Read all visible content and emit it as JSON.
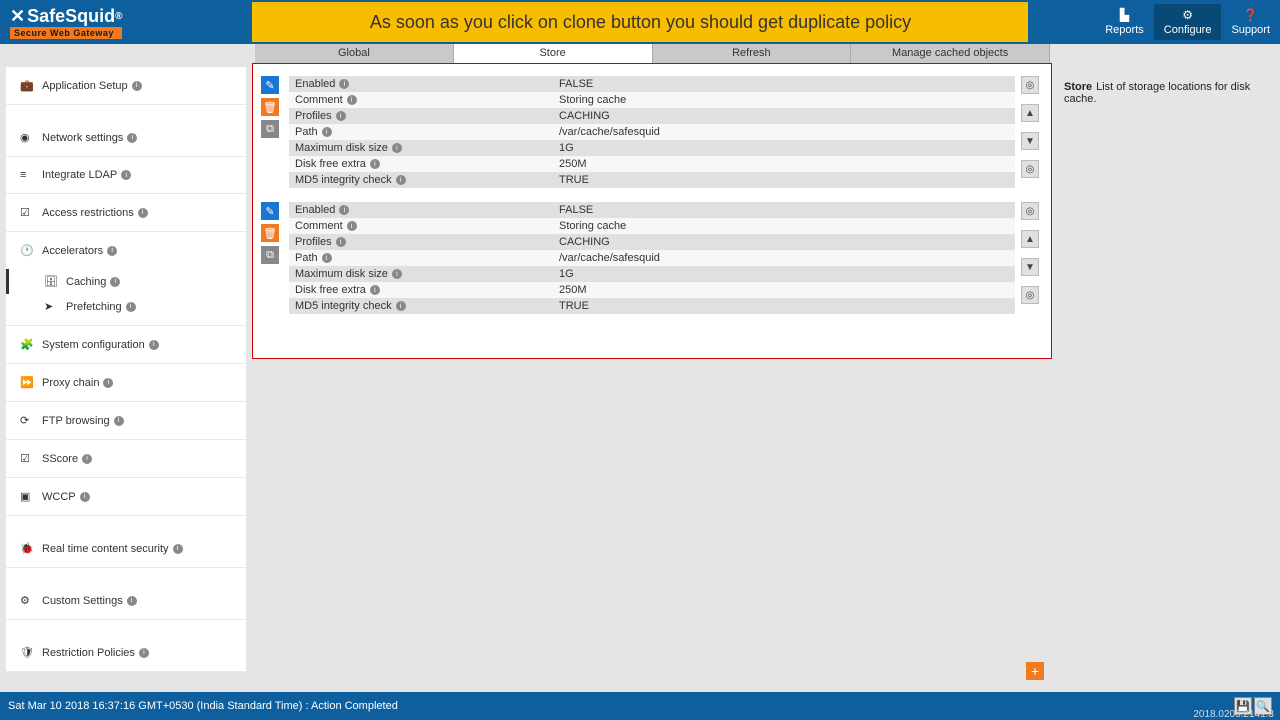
{
  "header": {
    "logo_main": "SafeSquid",
    "logo_reg": "®",
    "logo_sub": "Secure Web Gateway",
    "banner": "As soon as you click on clone button you should get duplicate policy",
    "reports": "Reports",
    "configure": "Configure",
    "support": "Support"
  },
  "tabs": {
    "global": "Global",
    "store": "Store",
    "refresh": "Refresh",
    "manage": "Manage cached objects"
  },
  "sidebar": {
    "app_setup": "Application Setup",
    "network": "Network settings",
    "ldap": "Integrate LDAP",
    "access": "Access restrictions",
    "accel": "Accelerators",
    "caching": "Caching",
    "prefetch": "Prefetching",
    "sysconf": "System configuration",
    "proxy": "Proxy chain",
    "ftp": "FTP browsing",
    "sscore": "SScore",
    "wccp": "WCCP",
    "realtime": "Real time content security",
    "custom": "Custom Settings",
    "restrict": "Restriction Policies"
  },
  "help": {
    "title": "Store",
    "text": "List of storage locations for disk cache."
  },
  "labels": {
    "enabled": "Enabled",
    "comment": "Comment",
    "profiles": "Profiles",
    "path": "Path",
    "maxdisk": "Maximum disk size",
    "diskfree": "Disk free extra",
    "md5": "MD5 integrity check"
  },
  "policies": [
    {
      "enabled": "FALSE",
      "comment": "Storing cache",
      "profiles": "CACHING",
      "path": "/var/cache/safesquid",
      "maxdisk": "1G",
      "diskfree": "250M",
      "md5": "TRUE"
    },
    {
      "enabled": "FALSE",
      "comment": "Storing cache",
      "profiles": "CACHING",
      "path": "/var/cache/safesquid",
      "maxdisk": "1G",
      "diskfree": "250M",
      "md5": "TRUE"
    }
  ],
  "footer": {
    "status": "Sat Mar 10 2018 16:37:16 GMT+0530 (India Standard Time) : Action Completed",
    "version": "2018.0206.2141.3"
  }
}
